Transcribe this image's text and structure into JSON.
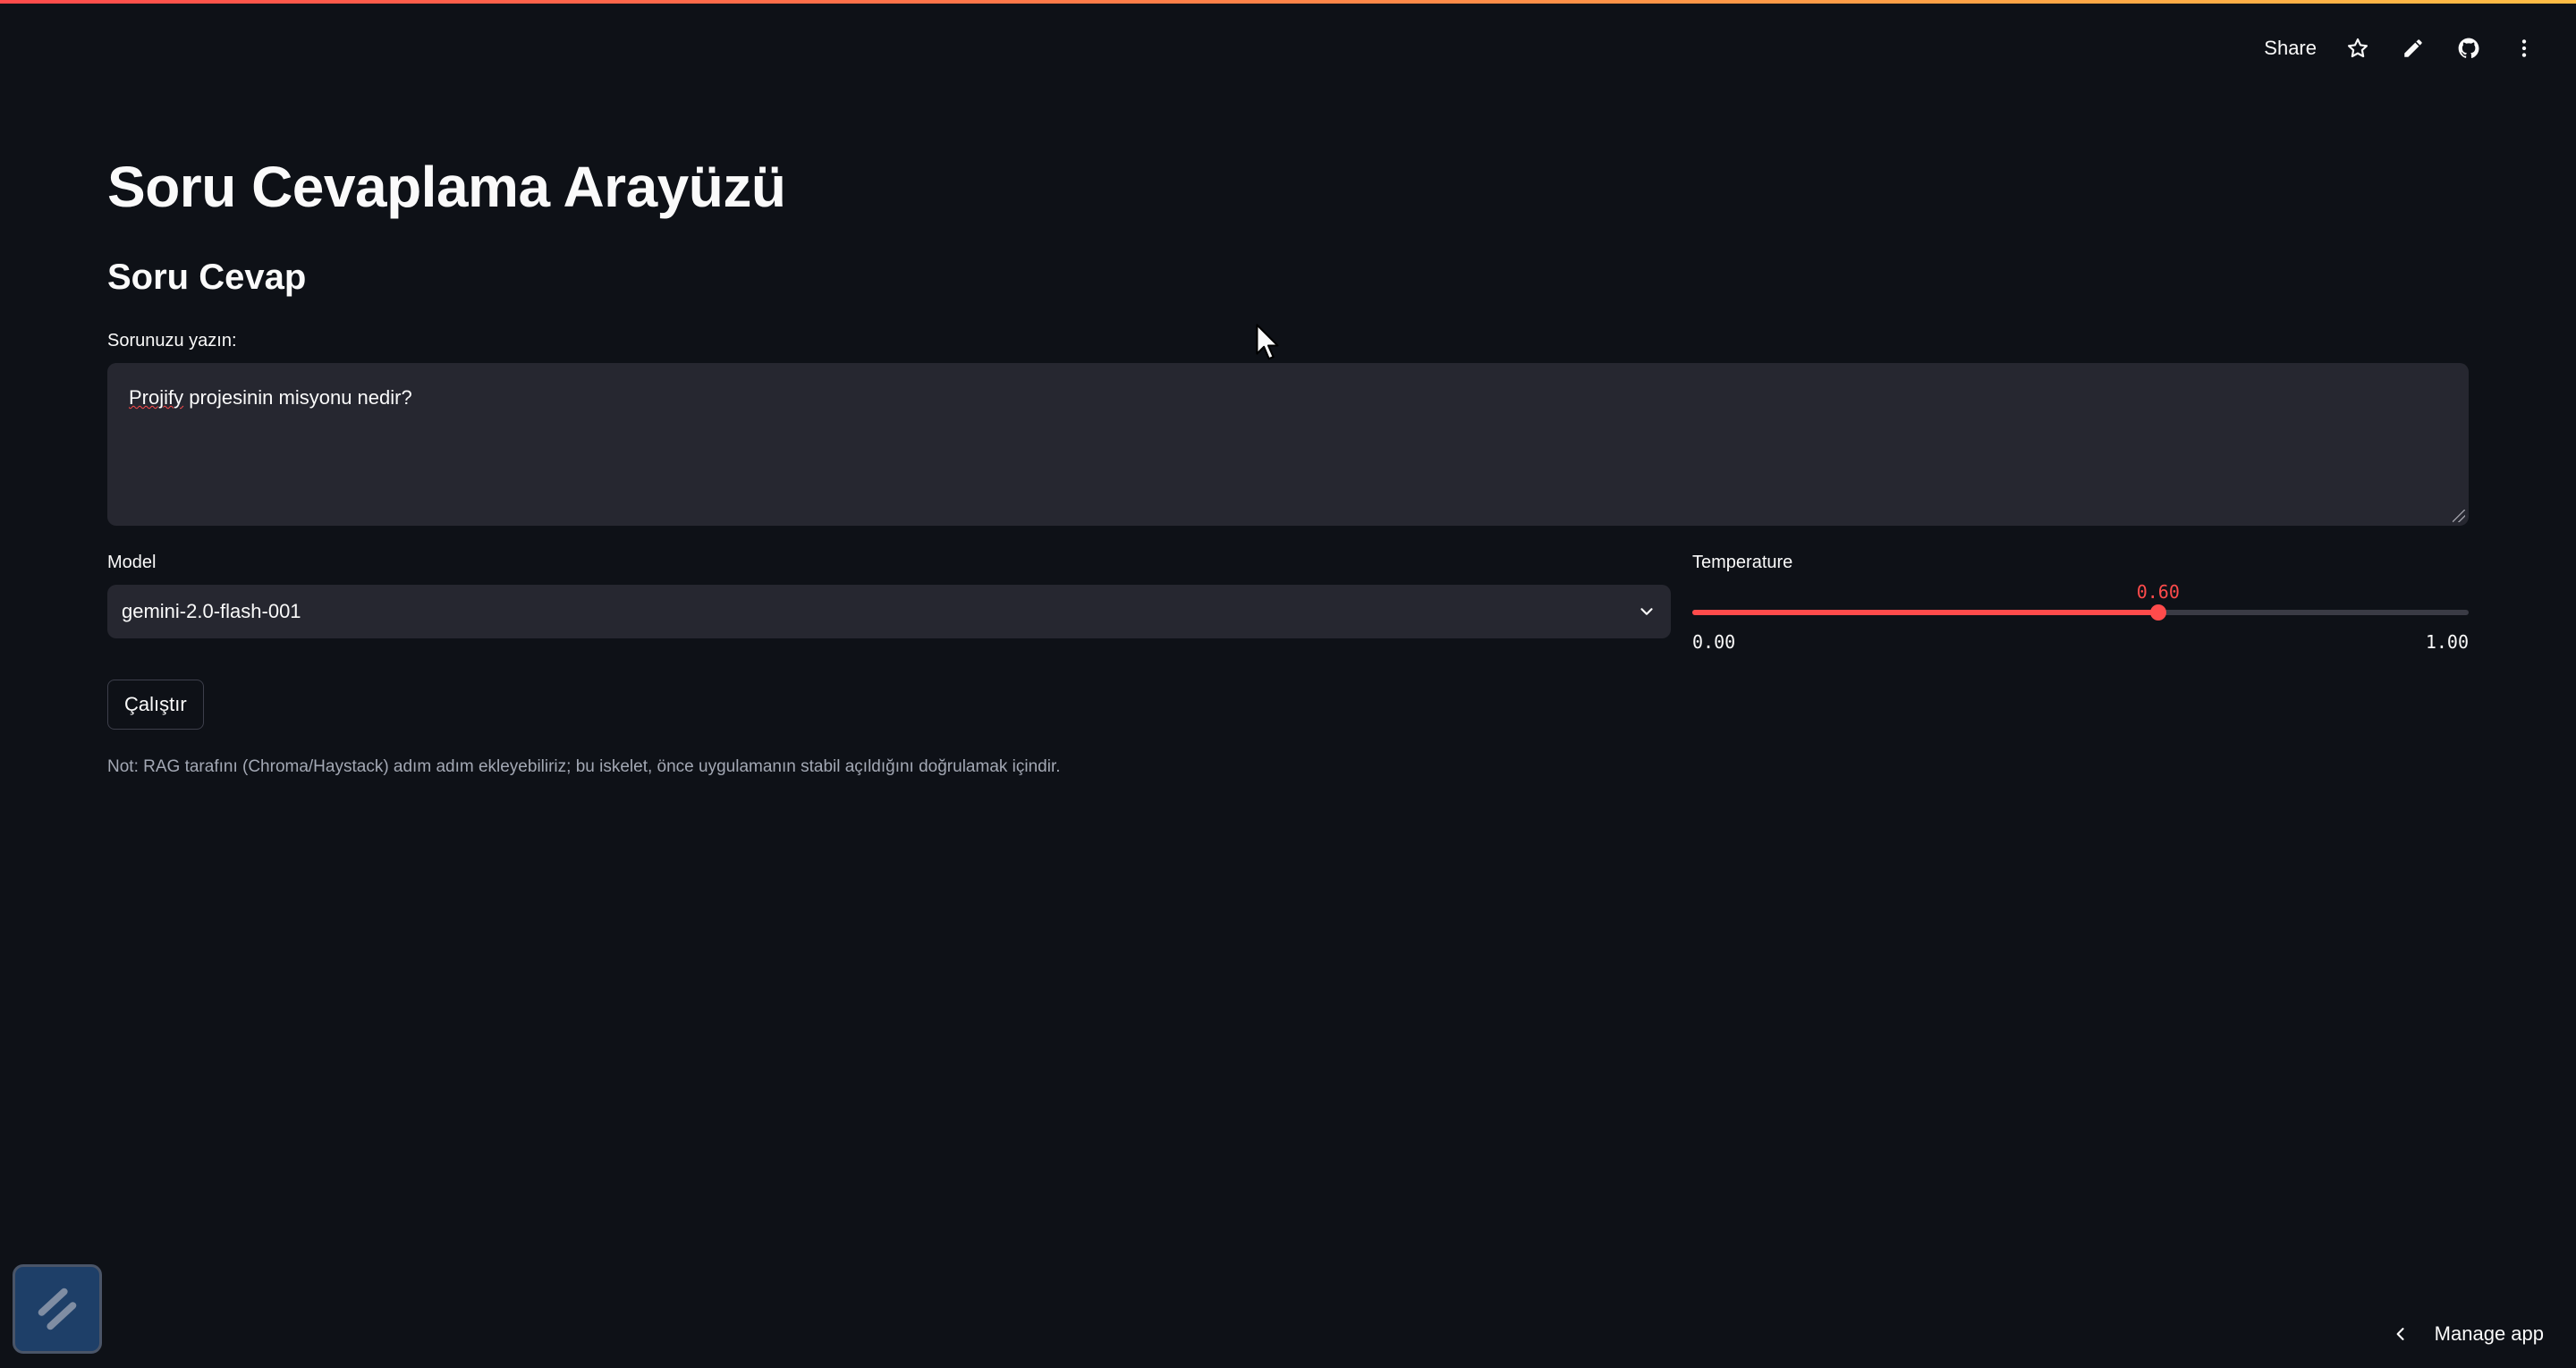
{
  "header": {
    "share_label": "Share",
    "icons": [
      "star-icon",
      "pencil-icon",
      "github-icon",
      "more-vertical-icon"
    ]
  },
  "main": {
    "title": "Soru Cevaplama Arayüzü",
    "subheader": "Soru Cevap",
    "question": {
      "label": "Sorunuzu yazın:",
      "value_misspelled": "Projify",
      "value_rest": " projesinin misyonu nedir?"
    },
    "model": {
      "label": "Model",
      "selected": "gemini-2.0-flash-001"
    },
    "temperature": {
      "label": "Temperature",
      "value": 0.6,
      "value_text": "0.60",
      "min_text": "0.00",
      "max_text": "1.00",
      "min": 0,
      "max": 1
    },
    "run_button": "Çalıştır",
    "note": "Not: RAG tarafını (Chroma/Haystack) adım adım ekleyebiliriz; bu iskelet, önce uygulamanın stabil açıldığını doğrulamak içindir."
  },
  "footer": {
    "manage_app": "Manage app"
  },
  "colors": {
    "background": "#0e1117",
    "input_bg": "#262730",
    "accent": "#ff4b4b",
    "text": "#fafafa",
    "muted_text": "#a3a8b4"
  }
}
